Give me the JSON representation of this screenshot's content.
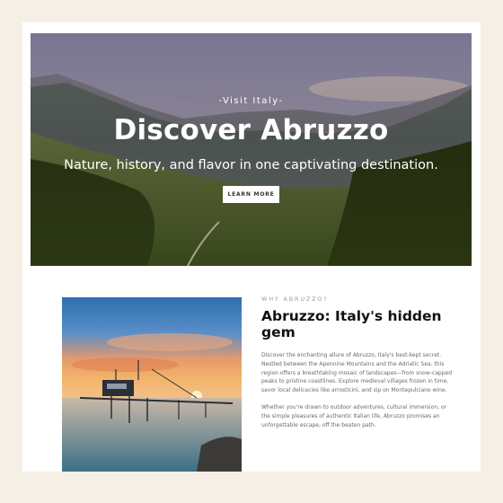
{
  "hero": {
    "eyebrow": "-Visit Italy-",
    "title": "Discover Abruzzo",
    "subtitle": "Nature, history, and flavor in one captivating destination.",
    "button_label": "LEARN MORE"
  },
  "about": {
    "kicker": "WHY ABRUZZO?",
    "title": "Abruzzo: Italy's hidden gem",
    "paragraph1": "Discover the enchanting allure of Abruzzo, Italy's best-kept secret. Nestled between the Apennine Mountains and the Adriatic Sea, this region offers a breathtaking mosaic of landscapes—from snow-capped peaks to pristine coastlines. Explore medieval villages frozen in time, savor local delicacies like arrosticini, and sip on Montepulciano wine.",
    "paragraph2": "Whether you're drawn to outdoor adventures, cultural immersion, or the simple pleasures of authentic Italian life, Abruzzo promises an unforgettable escape, off the beaten path."
  },
  "colors": {
    "page_background": "#f6efe6",
    "card_background": "#ffffff",
    "button_background": "#ffffff",
    "title_text": "#111111",
    "body_text": "#6a6a6a"
  },
  "images": {
    "hero": "mountain-valley-landscape",
    "feature": "trabocco-sunset-sea"
  }
}
